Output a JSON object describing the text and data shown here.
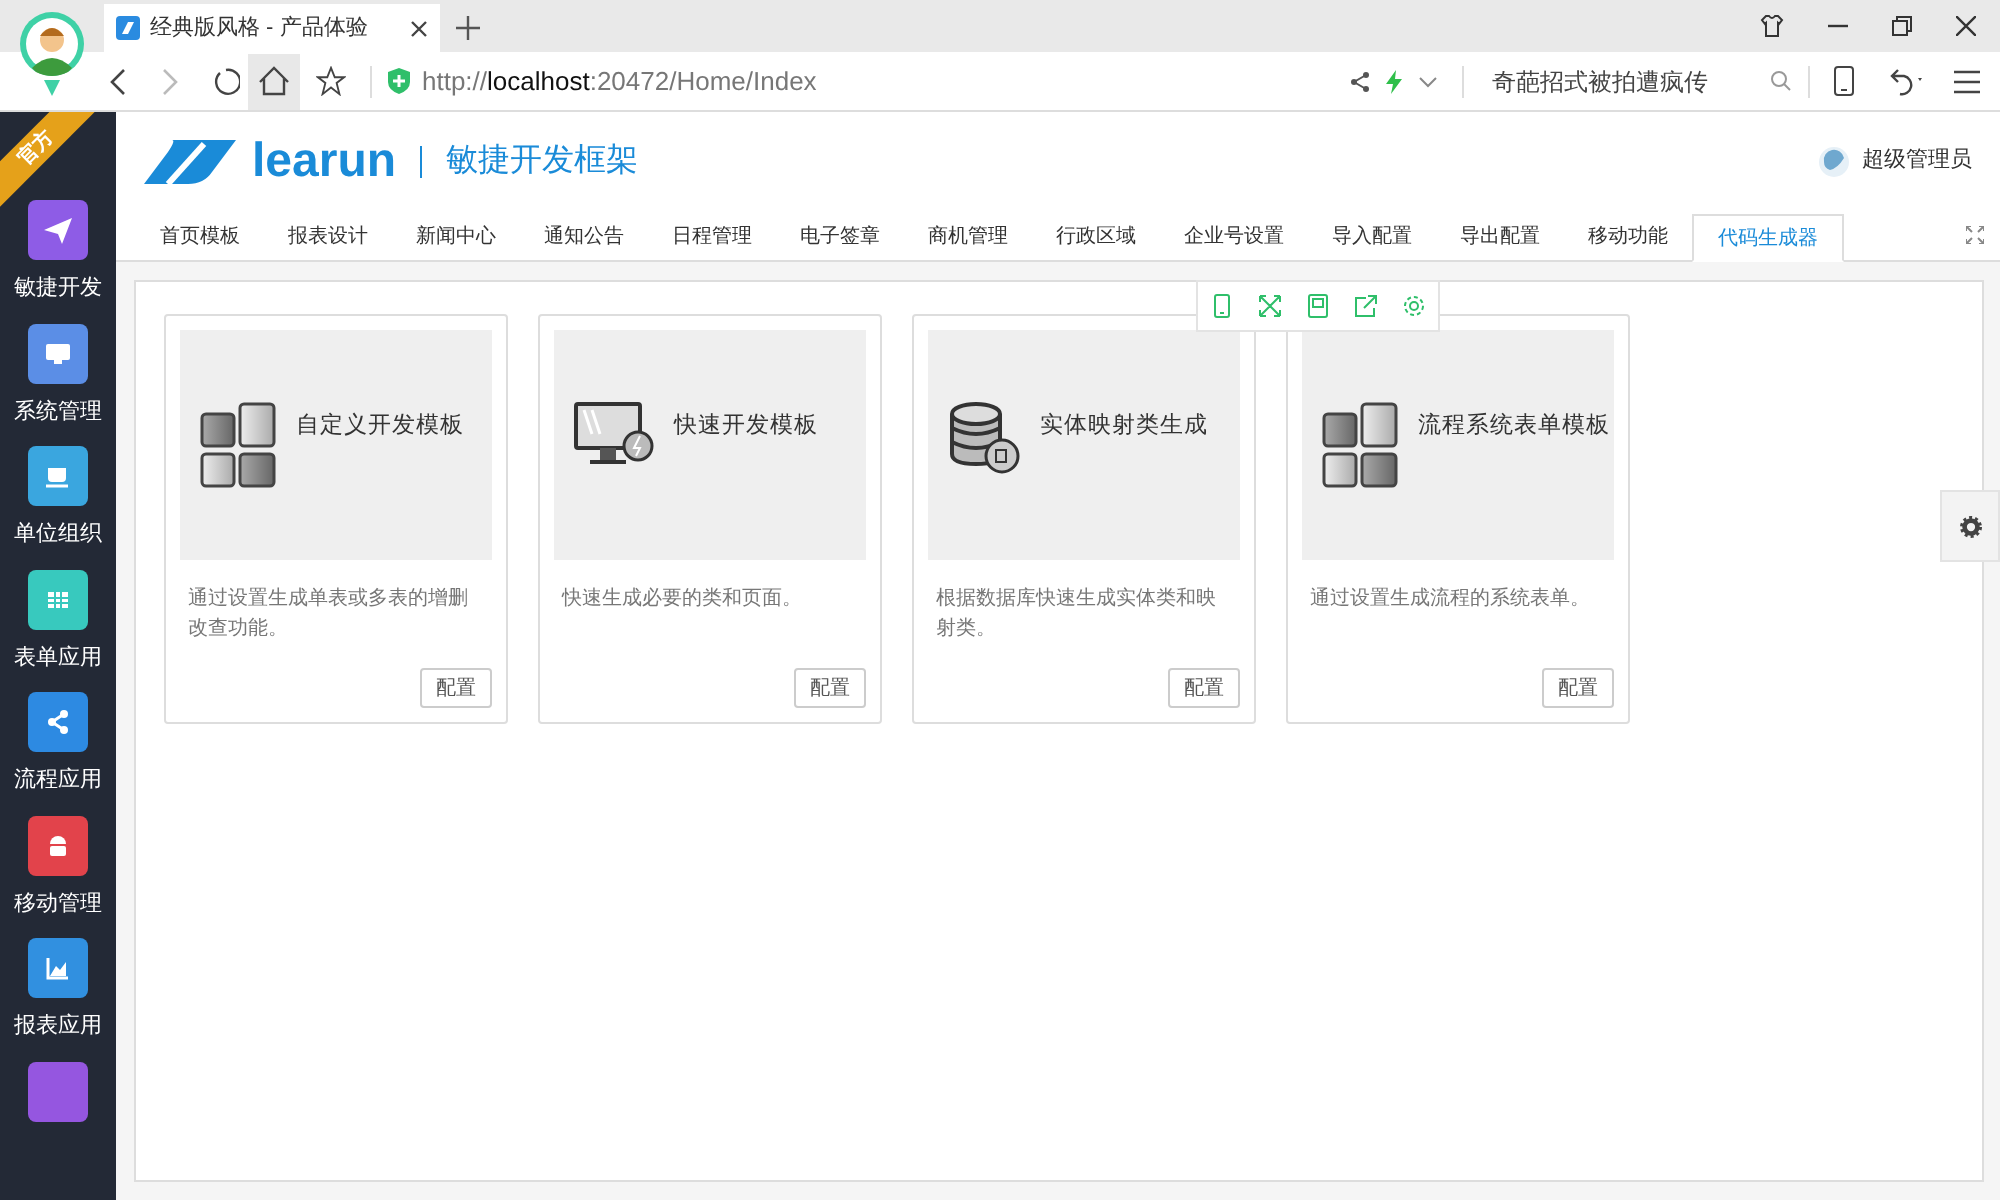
{
  "browser": {
    "tab_title": "经典版风格 - 产品体验",
    "url": "http://**localhost**:20472/Home/Index",
    "search": {
      "placeholder": "奇葩招式被拍遭疯传"
    }
  },
  "header": {
    "brand": "learun",
    "subtitle": "敏捷开发框架",
    "user": "超级管理员"
  },
  "ribbon": "官方",
  "sidebar": {
    "items": [
      {
        "label": "敏捷开发",
        "color": "#8e5ce6",
        "kind": "send"
      },
      {
        "label": "系统管理",
        "color": "#5b8ee6",
        "kind": "monitor"
      },
      {
        "label": "单位组织",
        "color": "#3aa6df",
        "kind": "cup"
      },
      {
        "label": "表单应用",
        "color": "#38c9be",
        "kind": "grid"
      },
      {
        "label": "流程应用",
        "color": "#2d8ae2",
        "kind": "share"
      },
      {
        "label": "移动管理",
        "color": "#e2434b",
        "kind": "android"
      },
      {
        "label": "报表应用",
        "color": "#3190e0",
        "kind": "chart"
      },
      {
        "color": "#9556e0",
        "kind": "blank"
      }
    ]
  },
  "tabs": [
    {
      "label": "首页模板",
      "selected": false
    },
    {
      "label": "报表设计",
      "selected": false
    },
    {
      "label": "新闻中心",
      "selected": false
    },
    {
      "label": "通知公告",
      "selected": false
    },
    {
      "label": "日程管理",
      "selected": false
    },
    {
      "label": "电子签章",
      "selected": false
    },
    {
      "label": "商机管理",
      "selected": false
    },
    {
      "label": "行政区域",
      "selected": false
    },
    {
      "label": "企业号设置",
      "selected": false
    },
    {
      "label": "导入配置",
      "selected": false
    },
    {
      "label": "导出配置",
      "selected": false
    },
    {
      "label": "移动功能",
      "selected": false
    },
    {
      "label": "代码生成器",
      "selected": true
    }
  ],
  "cards": [
    {
      "title": "自定义开发模板",
      "description": "通过设置生成单表或多表的增删改查功能。",
      "button": "配置",
      "kind": "tiles"
    },
    {
      "title": "快速开发模板",
      "description": "快速生成必要的类和页面。",
      "button": "配置",
      "kind": "monitor"
    },
    {
      "title": "实体映射类生成",
      "description": "根据数据库快速生成实体类和映射类。",
      "button": "配置",
      "kind": "database"
    },
    {
      "title": "流程系统表单模板",
      "description": "通过设置生成流程的系统表单。",
      "button": "配置",
      "kind": "tiles"
    }
  ]
}
